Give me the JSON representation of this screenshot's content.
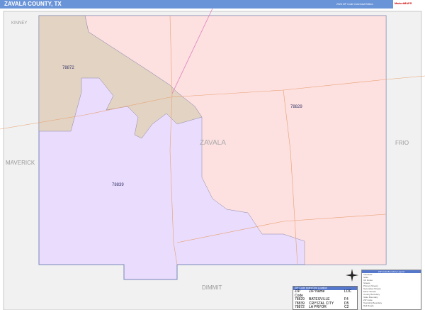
{
  "header": {
    "title": "ZAVALA COUNTY, TX",
    "edition": "2026 ZIP Code ColorCast Edition",
    "logo": "MarketMAPS"
  },
  "map": {
    "county_label": "ZAVALA",
    "neighbors": [
      "KINNEY",
      "MAVERICK",
      "FRIO",
      "DIMMIT"
    ],
    "zips": [
      {
        "code": "78872",
        "color": "#e3d3c3"
      },
      {
        "code": "78829",
        "color": "#fde0e0"
      },
      {
        "code": "78839",
        "color": "#eadcfc"
      }
    ]
  },
  "zip_table": {
    "title": "ZIP Code Index/Grid Location",
    "headers": [
      "ZIP Code",
      "ZIP Name",
      "LOC"
    ],
    "rows": [
      [
        "78829",
        "BATESVILLE",
        "F4"
      ],
      [
        "78839",
        "CRYSTAL CITY",
        "D5"
      ],
      [
        "78872",
        "LA PRYOR",
        "C2"
      ]
    ]
  },
  "legend": {
    "title": "ZIP Code Boundary Legend",
    "items": [
      "Interstate",
      "State",
      "US Route",
      "Streets",
      "Primary Streets",
      "Secondary Streets",
      "Minor Streets",
      "County Boundary",
      "State Boundary",
      "ZIP Code",
      "Township Boundary",
      "Rail Roads"
    ]
  }
}
